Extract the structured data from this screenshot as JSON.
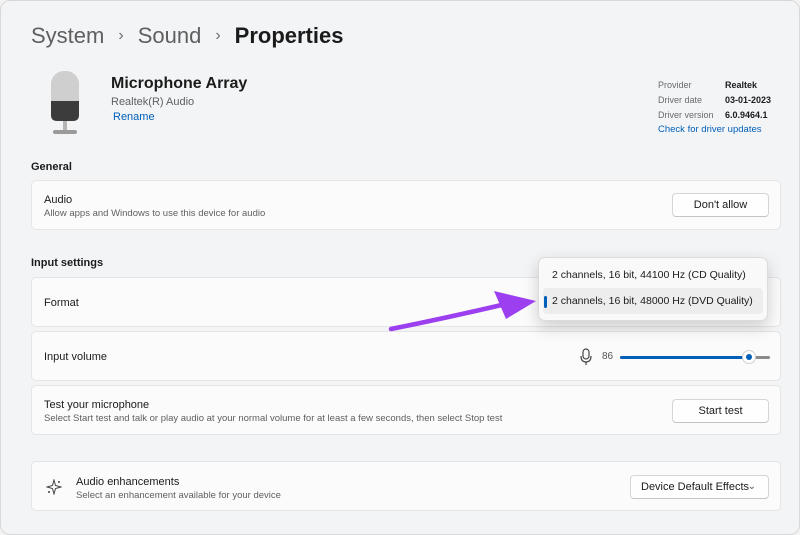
{
  "breadcrumb": {
    "level1": "System",
    "level2": "Sound",
    "level3": "Properties"
  },
  "device": {
    "name": "Microphone Array",
    "subtitle": "Realtek(R) Audio",
    "rename_label": "Rename",
    "icon": "microphone-icon"
  },
  "driver": {
    "provider_label": "Provider",
    "provider_value": "Realtek",
    "date_label": "Driver date",
    "date_value": "03-01-2023",
    "version_label": "Driver version",
    "version_value": "6.0.9464.1",
    "update_link": "Check for driver updates"
  },
  "general": {
    "section_title": "General",
    "audio_title": "Audio",
    "audio_desc": "Allow apps and Windows to use this device for audio",
    "audio_button": "Don't allow"
  },
  "input_settings": {
    "section_title": "Input settings",
    "format_label": "Format",
    "format_options": [
      "2 channels, 16 bit, 44100 Hz (CD Quality)",
      "2 channels, 16 bit, 48000 Hz (DVD Quality)"
    ],
    "format_selected_index": 1,
    "volume_label": "Input volume",
    "volume_value": "86",
    "volume_fraction": 0.86,
    "test_title": "Test your microphone",
    "test_desc": "Select Start test and talk or play audio at your normal volume for at least a few seconds, then select Stop test",
    "test_button": "Start test"
  },
  "enhancements": {
    "title": "Audio enhancements",
    "desc": "Select an enhancement available for your device",
    "dropdown_value": "Device Default Effects",
    "icon": "sparkle-icon"
  },
  "colors": {
    "accent": "#005fb8",
    "annotation_arrow": "#9b3ff0"
  }
}
